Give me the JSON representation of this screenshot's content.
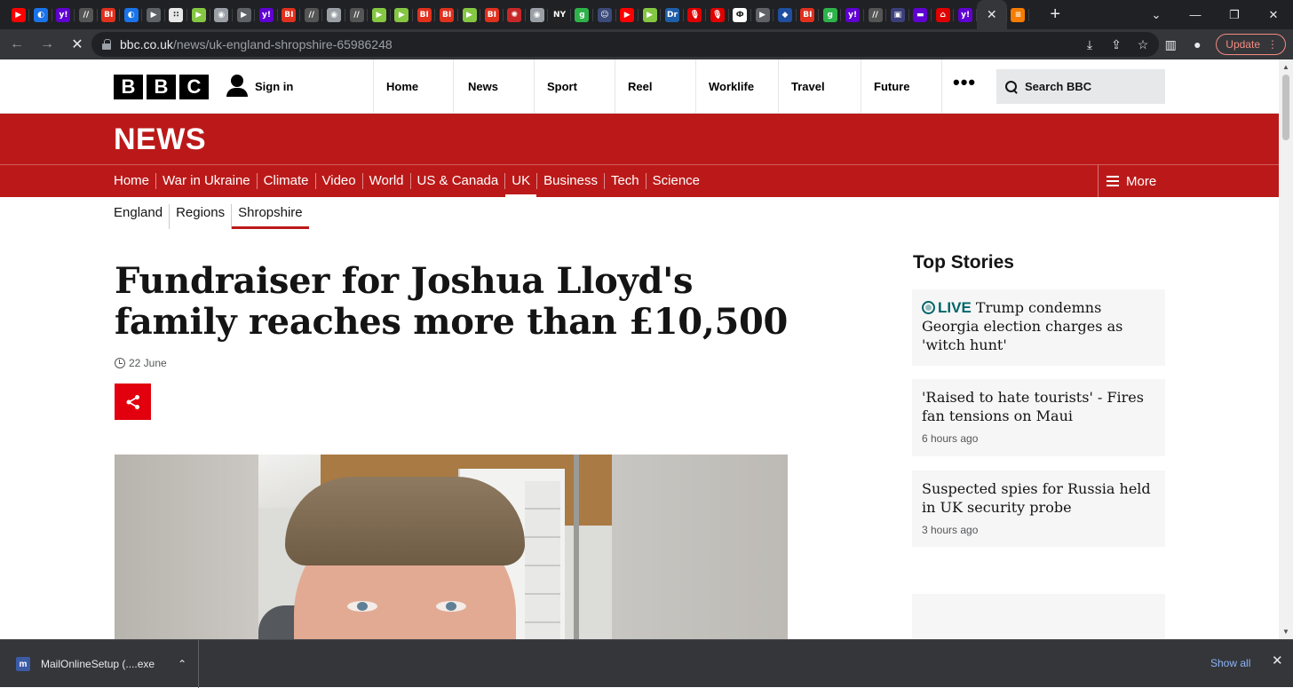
{
  "browser": {
    "tabs": [
      {
        "icon": "youtube-icon",
        "color": "#ff0000",
        "glyph": "▶"
      },
      {
        "icon": "shield-icon",
        "color": "#1a73e8",
        "glyph": "◐"
      },
      {
        "icon": "yahoo-icon",
        "color": "#6001d2",
        "glyph": "y!"
      },
      {
        "icon": "ars-icon",
        "color": "#555555",
        "glyph": "//"
      },
      {
        "icon": "business-insider-icon",
        "color": "#e0301e",
        "glyph": "BI"
      },
      {
        "icon": "shield-icon",
        "color": "#1a73e8",
        "glyph": "◐"
      },
      {
        "icon": "play-icon",
        "color": "#5f6368",
        "glyph": "▶"
      },
      {
        "icon": "dotted-icon",
        "color": "#e8e8e8",
        "glyph": "∷"
      },
      {
        "icon": "rumble-icon",
        "color": "#85c742",
        "glyph": "▶"
      },
      {
        "icon": "globe-icon",
        "color": "#9aa0a6",
        "glyph": "◉"
      },
      {
        "icon": "play-icon",
        "color": "#5f6368",
        "glyph": "▶"
      },
      {
        "icon": "yahoo-icon",
        "color": "#6001d2",
        "glyph": "y!"
      },
      {
        "icon": "business-insider-icon",
        "color": "#e0301e",
        "glyph": "BI"
      },
      {
        "icon": "ars-icon",
        "color": "#555555",
        "glyph": "//"
      },
      {
        "icon": "globe-icon",
        "color": "#9aa0a6",
        "glyph": "◉"
      },
      {
        "icon": "ars-icon",
        "color": "#555555",
        "glyph": "//"
      },
      {
        "icon": "rumble-icon",
        "color": "#85c742",
        "glyph": "▶"
      },
      {
        "icon": "rumble-icon",
        "color": "#85c742",
        "glyph": "▶"
      },
      {
        "icon": "business-insider-icon",
        "color": "#e0301e",
        "glyph": "BI"
      },
      {
        "icon": "business-insider-icon",
        "color": "#e0301e",
        "glyph": "BI"
      },
      {
        "icon": "rumble-icon",
        "color": "#85c742",
        "glyph": "▶"
      },
      {
        "icon": "business-insider-icon",
        "color": "#e0301e",
        "glyph": "BI"
      },
      {
        "icon": "burst-icon",
        "color": "#c62828",
        "glyph": "✺"
      },
      {
        "icon": "globe-icon",
        "color": "#9aa0a6",
        "glyph": "◉"
      },
      {
        "icon": "news-icon",
        "color": "#222222",
        "glyph": "NY"
      },
      {
        "icon": "gizmodo-icon",
        "color": "#2db34a",
        "glyph": "g"
      },
      {
        "icon": "avatar-icon",
        "color": "#3c4a7a",
        "glyph": "☺"
      },
      {
        "icon": "youtube-icon",
        "color": "#ff0000",
        "glyph": "▶"
      },
      {
        "icon": "rumble-icon",
        "color": "#85c742",
        "glyph": "▶"
      },
      {
        "icon": "dr-icon",
        "color": "#1f5faa",
        "glyph": "Dr"
      },
      {
        "icon": "microphone-icon",
        "color": "#e00000",
        "glyph": "🎙"
      },
      {
        "icon": "microphone-icon",
        "color": "#e00000",
        "glyph": "🎙"
      },
      {
        "icon": "om-icon",
        "color": "#ffffff",
        "glyph": "Ф"
      },
      {
        "icon": "play-icon",
        "color": "#5f6368",
        "glyph": "▶"
      },
      {
        "icon": "cube-icon",
        "color": "#1e4fa0",
        "glyph": "◆"
      },
      {
        "icon": "business-insider-icon",
        "color": "#e0301e",
        "glyph": "BI"
      },
      {
        "icon": "gizmodo-icon",
        "color": "#2db34a",
        "glyph": "g"
      },
      {
        "icon": "yahoo-icon",
        "color": "#6001d2",
        "glyph": "y!"
      },
      {
        "icon": "ars-icon",
        "color": "#555555",
        "glyph": "//"
      },
      {
        "icon": "crest-icon",
        "color": "#3b3f7a",
        "glyph": "▣"
      },
      {
        "icon": "yahoo-mail-icon",
        "color": "#6001d2",
        "glyph": "▬"
      },
      {
        "icon": "house-icon",
        "color": "#e00000",
        "glyph": "⌂"
      },
      {
        "icon": "yahoo-icon",
        "color": "#6001d2",
        "glyph": "y!"
      }
    ],
    "active_tab": {
      "icon": "close-icon",
      "glyph": "✕"
    },
    "extra_tab": {
      "icon": "bars-icon",
      "color": "#f57c00",
      "glyph": "≡"
    },
    "url_host": "bbc.co.uk",
    "url_path": "/news/uk-england-shropshire-65986248",
    "update_label": "Update"
  },
  "bbc": {
    "logo": [
      "B",
      "B",
      "C"
    ],
    "signin": "Sign in",
    "topnav": [
      "Home",
      "News",
      "Sport",
      "Reel",
      "Worklife",
      "Travel",
      "Future"
    ],
    "more_dots": "•••",
    "search_placeholder": "Search BBC"
  },
  "news": {
    "wordmark": "NEWS",
    "nav": [
      "Home",
      "War in Ukraine",
      "Climate",
      "Video",
      "World",
      "US & Canada",
      "UK",
      "Business",
      "Tech",
      "Science"
    ],
    "nav_current": "UK",
    "more": "More",
    "subnav": [
      "England",
      "Regions",
      "Shropshire"
    ],
    "subnav_current": "Shropshire"
  },
  "article": {
    "headline": "Fundraiser for Joshua Lloyd's family reaches more than £10,500",
    "date": "22 June"
  },
  "sidebar": {
    "title": "Top Stories",
    "stories": [
      {
        "live": "LIVE",
        "title": "Trump condemns Georgia election charges as 'witch hunt'",
        "ago": ""
      },
      {
        "live": "",
        "title": "'Raised to hate tourists' - Fires fan tensions on Maui",
        "ago": "6 hours ago"
      },
      {
        "live": "",
        "title": "Suspected spies for Russia held in UK security probe",
        "ago": "3 hours ago"
      }
    ]
  },
  "downloads": {
    "file": "MailOnlineSetup (....exe",
    "show_all": "Show all"
  }
}
